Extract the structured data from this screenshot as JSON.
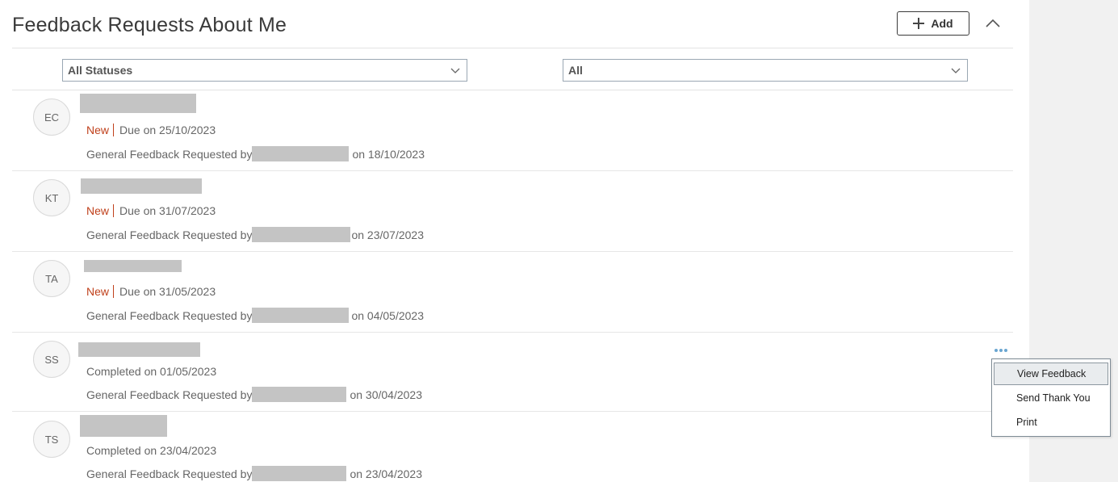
{
  "header": {
    "title": "Feedback Requests About Me",
    "add_label": "Add"
  },
  "filters": {
    "status_selected": "All Statuses",
    "type_selected": "All"
  },
  "rows": [
    {
      "initials": "EC",
      "status": "New",
      "date_label": "Due on 25/10/2023",
      "request_prefix": "General Feedback Requested by",
      "request_suffix": "on 18/10/2023"
    },
    {
      "initials": "KT",
      "status": "New",
      "date_label": "Due on 31/07/2023",
      "request_prefix": "General Feedback Requested by",
      "request_suffix": "on 23/07/2023"
    },
    {
      "initials": "TA",
      "status": "New",
      "date_label": "Due on 31/05/2023",
      "request_prefix": "General Feedback Requested by",
      "request_suffix": "on 04/05/2023"
    },
    {
      "initials": "SS",
      "status": "",
      "date_label": "Completed on 01/05/2023",
      "request_prefix": "General Feedback Requested by",
      "request_suffix": "on 30/04/2023"
    },
    {
      "initials": "TS",
      "status": "",
      "date_label": "Completed on 23/04/2023",
      "request_prefix": "General Feedback Requested by",
      "request_suffix": "on 23/04/2023"
    }
  ],
  "context_menu": {
    "items": [
      "View Feedback",
      "Send Thank You",
      "Print"
    ],
    "active_index": 0
  },
  "colors": {
    "new_status": "#c0411c",
    "more_icon": "#6aa6d1",
    "redaction": "#c4c4c4"
  },
  "icons": {
    "add": "plus-icon",
    "collapse": "chevron-up-icon",
    "select": "chevron-down-icon",
    "actions": "more-horizontal-icon"
  }
}
